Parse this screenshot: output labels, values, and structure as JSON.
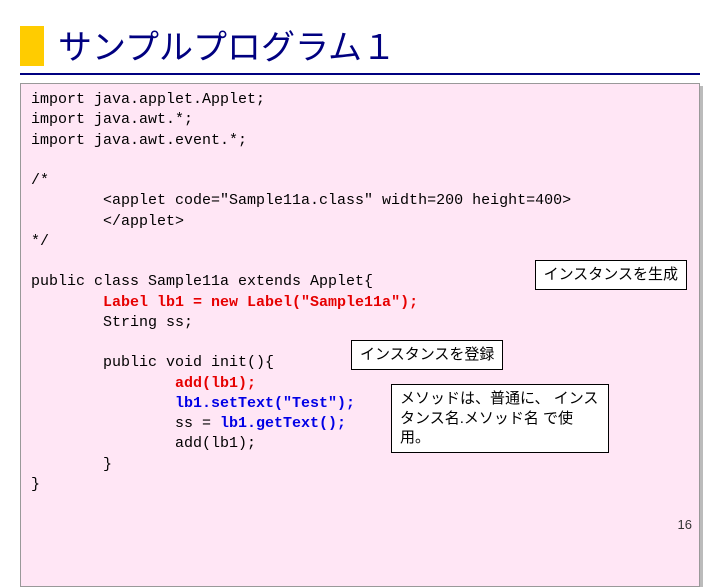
{
  "title": "サンプルプログラム１",
  "code": {
    "l1": "import java.applet.Applet;",
    "l2": "import java.awt.*;",
    "l3": "import java.awt.event.*;",
    "blank1": "",
    "l4": "/*",
    "l5": "        <applet code=\"Sample11a.class\" width=200 height=400>",
    "l6": "        </applet>",
    "l7": "*/",
    "blank2": "",
    "l8": "public class Sample11a extends Applet{",
    "l9a": "        ",
    "l9b": "Label lb1 = new Label(\"Sample11a\");",
    "l10": "        String ss;",
    "blank3": "",
    "l11": "        public void init(){",
    "l12a": "                ",
    "l12b": "add(lb1);",
    "l13a": "                ",
    "l13b": "lb1.setText(\"Test\");",
    "l14a": "                ss = ",
    "l14b": "lb1.getText();",
    "l15": "                add(lb1);",
    "l16": "        }",
    "l17": "}"
  },
  "callouts": {
    "c1": "インスタンスを生成",
    "c2": "インスタンスを登録",
    "c3": "メソッドは、普通に、\nインスタンス名.メソッド名\nで使用。"
  },
  "pagenum": "16"
}
